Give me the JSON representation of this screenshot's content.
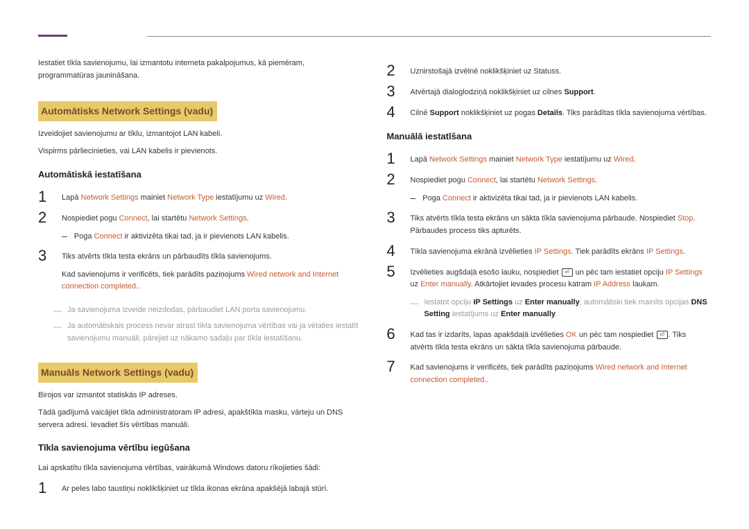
{
  "left": {
    "intro": "Iestatiet tīkla savienojumu, lai izmantotu interneta pakalpojumus, kā piemēram, programmatūras jaunināšana.",
    "section1": {
      "title": "Automātisks Network Settings (vadu)",
      "p1": "Izveidojiet savienojumu ar tīklu, izmantojot LAN kabeli.",
      "p2": "Vispirms pārliecinieties, vai LAN kabelis ir pievienots.",
      "sub": "Automātiskā iestatīšana",
      "step1_a": "Lapā ",
      "step1_b": "Network Settings",
      "step1_c": " mainiet ",
      "step1_d": "Network Type",
      "step1_e": " iestatījumu uz ",
      "step1_f": "Wired",
      "step1_g": ".",
      "step2_a": "Nospiediet pogu ",
      "step2_b": "Connect",
      "step2_c": ", lai startētu ",
      "step2_d": "Network Settings",
      "step2_e": ".",
      "bullet2_a": "Poga ",
      "bullet2_b": "Connect",
      "bullet2_c": " ir aktivizēta tikai tad, ja ir pievienots LAN kabelis.",
      "step3_a": "Tiks atvērts tīkla testa ekrāns un pārbaudīts tīkla savienojums.",
      "step3_b1": "Kad savienojums ir verificēts, tiek parādīts paziņojums ",
      "step3_b2": "Wired network and Internet connection completed.",
      "step3_b3": ".",
      "note1": "Ja savienojuma izveide neizdodas, pārbaudiet LAN porta savienojumu.",
      "note2": "Ja automātiskais process nevar atrast tīkla savienojuma vērtības vai ja vēlaties iestatīt savienojumu manuāli, pārejiet uz nākamo sadaļu par tīkla iestatīšanu."
    },
    "section2": {
      "title": "Manuāls Network Settings (vadu)",
      "p1": "Birojos var izmantot statiskās IP adreses.",
      "p2": "Tādā gadījumā vaicājiet tīkla administratoram IP adresi, apakštīkla masku, vārteju un DNS servera adresi. Ievadiet šīs vērtības manuāli.",
      "sub": "Tīkla savienojuma vērtību iegūšana",
      "p3": "Lai apskatītu tīkla savienojuma vērtības, vairākumā Windows datoru rīkojieties šādi:",
      "step1": "Ar peles labo taustiņu noklikšķiniet uz tīkla ikonas ekrāna apakšējā labajā stūrī."
    }
  },
  "right": {
    "step2": "Uznirstošajā izvēlnē noklikšķiniet uz Statuss.",
    "step3_a": "Atvērtajā dialoglodziņā noklikšķiniet uz cilnes ",
    "step3_b": "Support",
    "step3_c": ".",
    "step4_a": "Cilnē ",
    "step4_b": "Support",
    "step4_c": " noklikšķiniet uz pogas ",
    "step4_d": "Details",
    "step4_e": ". Tiks parādītas tīkla savienojuma vērtības.",
    "sub": "Manuālā iestatīšana",
    "m1_a": "Lapā ",
    "m1_b": "Network Settings",
    "m1_c": " mainiet ",
    "m1_d": "Network Type",
    "m1_e": " iestatījumu uz ",
    "m1_f": "Wired",
    "m1_g": ".",
    "m2_a": "Nospiediet pogu ",
    "m2_b": "Connect",
    "m2_c": ", lai startētu ",
    "m2_d": "Network Settings",
    "m2_e": ".",
    "m2_bullet_a": "Poga ",
    "m2_bullet_b": "Connect",
    "m2_bullet_c": " ir aktivizēta tikai tad, ja ir pievienots LAN kabelis.",
    "m3_a": "Tiks atvērts tīkla testa ekrāns un sākta tīkla savienojuma pārbaude. Nospiediet ",
    "m3_b": "Stop",
    "m3_c": ". Pārbaudes process tiks apturēts.",
    "m4_a": "Tīkla savienojuma ekrānā izvēlieties ",
    "m4_b": "IP Settings",
    "m4_c": ". Tiek parādīts ekrāns ",
    "m4_d": "IP Settings",
    "m4_e": ".",
    "m5_a": "Izvēlieties augšdaļā esošo lauku, nospiediet ",
    "m5_b": " un pēc tam iestatiet opciju ",
    "m5_c": "IP Settings",
    "m5_d": " uz ",
    "m5_e": "Enter manually",
    "m5_f": ". Atkārtojiet ievades procesu katram ",
    "m5_g": "IP Address",
    "m5_h": " laukam.",
    "m5_note_a": "Iestatot opciju ",
    "m5_note_b": "IP Settings",
    "m5_note_c": " uz ",
    "m5_note_d": "Enter manually",
    "m5_note_e": ", automātiski tiek mainīts opcijas ",
    "m5_note_f": "DNS Setting",
    "m5_note_g": " iestatījums uz ",
    "m5_note_h": "Enter manually",
    "m5_note_i": ".",
    "m6_a": "Kad tas ir izdarīts, lapas apakšdaļā izvēlieties ",
    "m6_b": "OK",
    "m6_c": " un pēc tam nospiediet ",
    "m6_d": ". Tiks atvērts tīkla testa ekrāns un sākta tīkla savienojuma pārbaude.",
    "m7_a": "Kad savienojums ir verificēts, tiek parādīts paziņojums ",
    "m7_b": "Wired network and Internet connection completed.",
    "m7_c": "."
  }
}
